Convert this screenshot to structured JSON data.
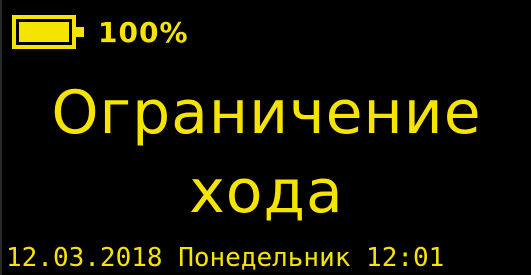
{
  "status": {
    "battery_icon": "battery-icon",
    "battery_level": 1.0,
    "battery_text": "100%"
  },
  "display": {
    "title_line1": "Ограничение",
    "title_line2": "хода"
  },
  "footer": {
    "date": "12.03.2018",
    "weekday": "Понедельник",
    "time": "12:01"
  },
  "colors": {
    "background": "#000000",
    "foreground": "#f5e400"
  }
}
